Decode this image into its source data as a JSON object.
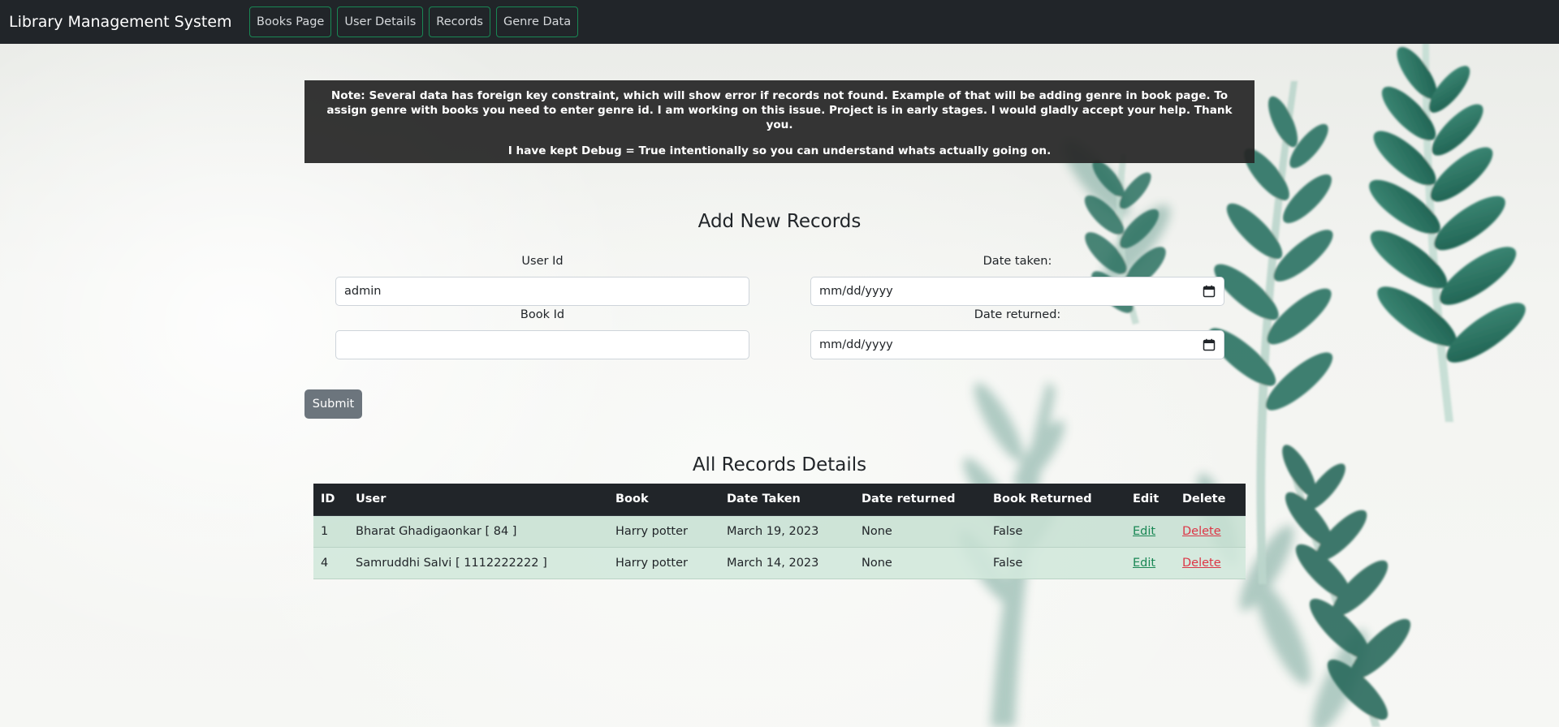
{
  "navbar": {
    "brand": "Library Management System",
    "links": [
      "Books Page",
      "User Details",
      "Records",
      "Genre Data"
    ]
  },
  "note": {
    "line1": "Note: Several data has foreign key constraint, which will show error if records not found. Example of that will be adding genre in book page. To assign genre with books you need to enter genre id. I am working on this issue. Project is in early stages. I would gladly accept your help. Thank you.",
    "line2": "I have kept Debug = True intentionally so you can understand whats actually going on."
  },
  "form": {
    "title": "Add New Records",
    "user_id_label": "User Id",
    "user_id_value": "admin",
    "book_id_label": "Book Id",
    "book_id_value": "",
    "date_taken_label": "Date taken:",
    "date_taken_value": "mm/dd/yyyy",
    "date_returned_label": "Date returned:",
    "date_returned_value": "mm/dd/yyyy",
    "submit_label": "Submit"
  },
  "table": {
    "title": "All Records Details",
    "headers": [
      "ID",
      "User",
      "Book",
      "Date Taken",
      "Date returned",
      "Book Returned",
      "Edit",
      "Delete"
    ],
    "rows": [
      {
        "id": "1",
        "user": "Bharat Ghadigaonkar [ 84 ]",
        "book": "Harry potter",
        "date_taken": "March 19, 2023",
        "date_returned": "None",
        "book_returned": "False",
        "edit": "Edit",
        "delete": "Delete"
      },
      {
        "id": "4",
        "user": "Samruddhi Salvi [ 1112222222 ]",
        "book": "Harry potter",
        "date_taken": "March 14, 2023",
        "date_returned": "None",
        "book_returned": "False",
        "edit": "Edit",
        "delete": "Delete"
      }
    ]
  },
  "colors": {
    "navbar_bg": "#212529",
    "nav_border": "#198754",
    "note_bg": "#262626",
    "submit_bg": "#6c757d",
    "edit_link": "#198754",
    "delete_link": "#dc3545"
  }
}
